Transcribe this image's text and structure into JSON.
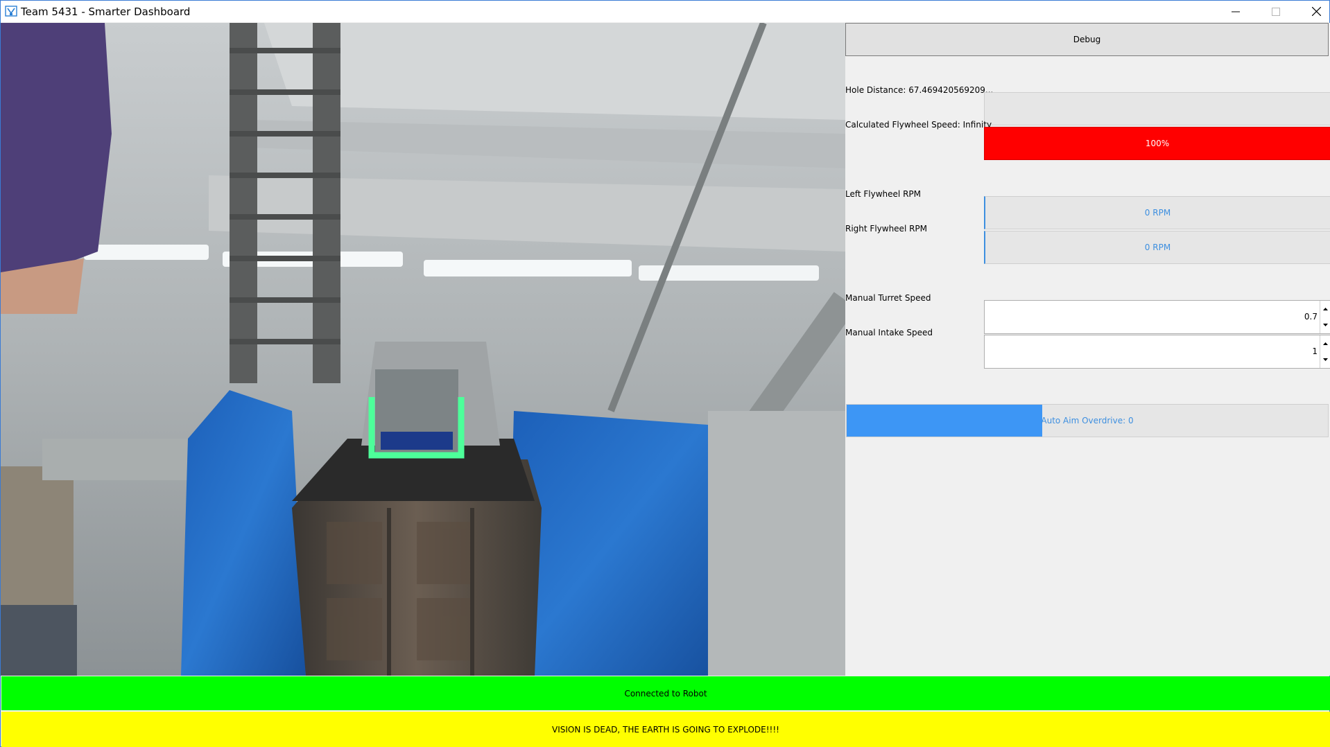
{
  "window": {
    "title": "Team 5431 - Smarter Dashboard",
    "icons": {
      "app": "robot-app-icon",
      "minimize": "minimize-icon",
      "maximize": "maximize-icon",
      "close": "close-icon"
    }
  },
  "camera": {
    "description_icon": "camera-feed"
  },
  "panel": {
    "debug_label": "Debug",
    "hole_distance_label": "Hole Distance: 67.469420569209...",
    "flywheel_speed_label": "Calculated Flywheel Speed: Infinity",
    "flywheel_speed_bar_text": "100%",
    "flywheel_speed_bar_percent": 100,
    "left_rpm_label": "Left Flywheel RPM",
    "left_rpm_value": "0 RPM",
    "right_rpm_label": "Right Flywheel RPM",
    "right_rpm_value": "0 RPM",
    "turret_speed_label": "Manual Turret Speed",
    "turret_speed_value": "0.7",
    "intake_speed_label": "Manual Intake Speed",
    "intake_speed_value": "1",
    "overdrive_label": "Auto Aim Overdrive: 0",
    "overdrive_fill_fraction": 0.406
  },
  "status": {
    "connection": "Connected to Robot",
    "vision": "VISION IS DEAD, THE EARTH IS GOING TO EXPLODE!!!!"
  },
  "colors": {
    "connected": "#00ff00",
    "vision_warning": "#ffff00",
    "flywheel_bar": "#ff0000",
    "accent_blue": "#3d8fe0"
  }
}
